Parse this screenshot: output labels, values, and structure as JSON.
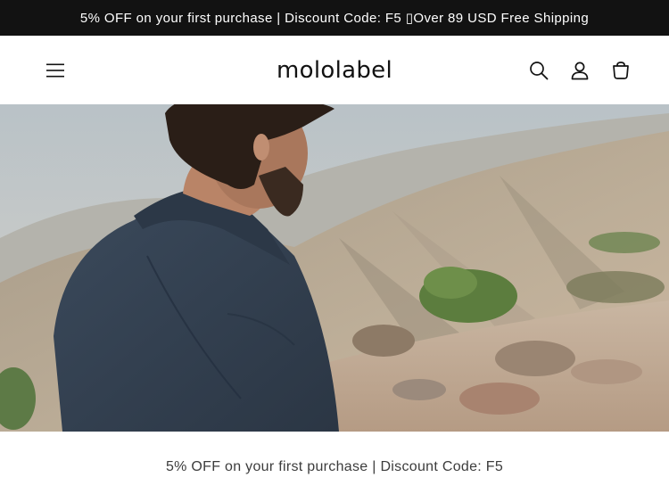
{
  "announcement": {
    "text": "5% OFF on your first purchase | Discount Code: F5 ▯Over 89 USD Free Shipping"
  },
  "header": {
    "logo": "mololabel",
    "icons": {
      "menu": "hamburger-menu-icon",
      "search": "search-icon",
      "account": "account-icon",
      "cart": "cart-icon"
    }
  },
  "hero": {
    "image_alt": "Man in denim jacket looking over a mountain valley"
  },
  "promo": {
    "text": "5% OFF on your first purchase | Discount Code: F5"
  },
  "colors": {
    "announcement_bg": "#121212",
    "text": "#121212",
    "promo_text": "#3c3c3c"
  }
}
